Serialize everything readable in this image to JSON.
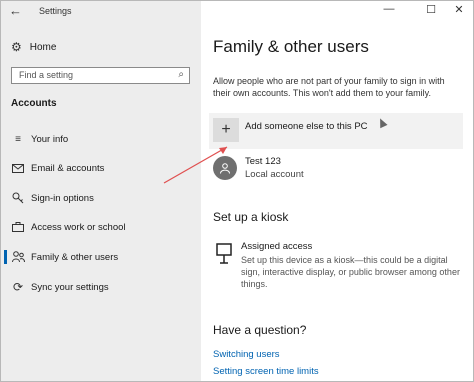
{
  "window": {
    "title": "Settings",
    "controls": {
      "minimize": "—",
      "maximize": "☐",
      "close": "✕"
    },
    "back_glyph": "←"
  },
  "sidebar": {
    "home_label": "Home",
    "search_placeholder": "Find a setting",
    "section_label": "Accounts",
    "items": [
      {
        "label": "Your info",
        "icon": "person-card-icon"
      },
      {
        "label": "Email & accounts",
        "icon": "mail-icon"
      },
      {
        "label": "Sign-in options",
        "icon": "key-icon"
      },
      {
        "label": "Access work or school",
        "icon": "briefcase-icon"
      },
      {
        "label": "Family & other users",
        "icon": "people-icon",
        "selected": true
      },
      {
        "label": "Sync your settings",
        "icon": "sync-icon"
      }
    ]
  },
  "main": {
    "title": "Family & other users",
    "description": "Allow people who are not part of your family to sign in with their own accounts. This won't add them to your family.",
    "add_button_label": "Add someone else to this PC",
    "user": {
      "name": "Test 123",
      "type": "Local account"
    },
    "kiosk_heading": "Set up a kiosk",
    "kiosk": {
      "title": "Assigned access",
      "description": "Set up this device as a kiosk—this could be a digital sign, interactive display, or public browser among other things."
    },
    "question_heading": "Have a question?",
    "links": [
      "Switching users",
      "Setting screen time limits"
    ]
  },
  "colors": {
    "accent": "#0063b1",
    "sidebar_bg": "#ededed",
    "annotation_arrow": "#e05050"
  }
}
